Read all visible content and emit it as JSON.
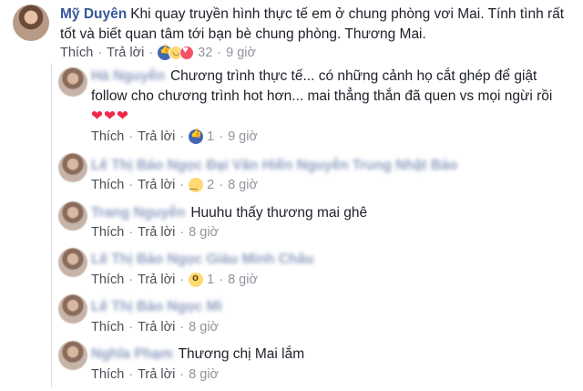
{
  "main_comment": {
    "author": "Mỹ Duyên",
    "text": "Khi quay truyền hình thực tế em ở chung phòng vơi Mai. Tính tình rất tốt và biết quan tâm tới bạn bè chung phòng. Thương Mai.",
    "like_label": "Thích",
    "reply_label": "Trả lời",
    "reaction_count": "32",
    "time": "9 giờ",
    "reactions": [
      "like-icon",
      "haha-icon",
      "heart-icon"
    ]
  },
  "replies": [
    {
      "author": "Hà Nguyễn",
      "text": "Chương trình thực tế... có những cảnh họ cắt ghép để giật follow cho chương trình hot hơn... mai thẳng thắn đã quen vs mọi ngừi rồi",
      "emoji": "❤❤❤",
      "like_label": "Thích",
      "reply_label": "Trả lời",
      "reaction": "like-icon",
      "reaction_count": "1",
      "time": "9 giờ"
    },
    {
      "author": "Lê Thị Bảo Ngọc Đại Văn Hiến Nguyễn Trung Nhật Bảo",
      "text": "",
      "like_label": "Thích",
      "reply_label": "Trả lời",
      "reaction": "sad-icon",
      "reaction_count": "2",
      "time": "8 giờ"
    },
    {
      "author": "Trang Nguyễn",
      "text": "Huuhu thấy thương mai ghê",
      "like_label": "Thích",
      "reply_label": "Trả lời",
      "time": "8 giờ"
    },
    {
      "author": "Lê Thị Bảo Ngọc Giàu Minh Châu",
      "text": "",
      "like_label": "Thích",
      "reply_label": "Trả lời",
      "reaction": "wow-icon",
      "reaction_count": "1",
      "time": "8 giờ"
    },
    {
      "author": "Lê Thị Bảo Ngọc Mi",
      "text": "",
      "like_label": "Thích",
      "reply_label": "Trả lời",
      "time": "8 giờ"
    },
    {
      "author": "Nghĩa Phạm",
      "text": "Thương chị Mai lắm",
      "like_label": "Thích",
      "reply_label": "Trả lời",
      "time": "8 giờ"
    }
  ]
}
